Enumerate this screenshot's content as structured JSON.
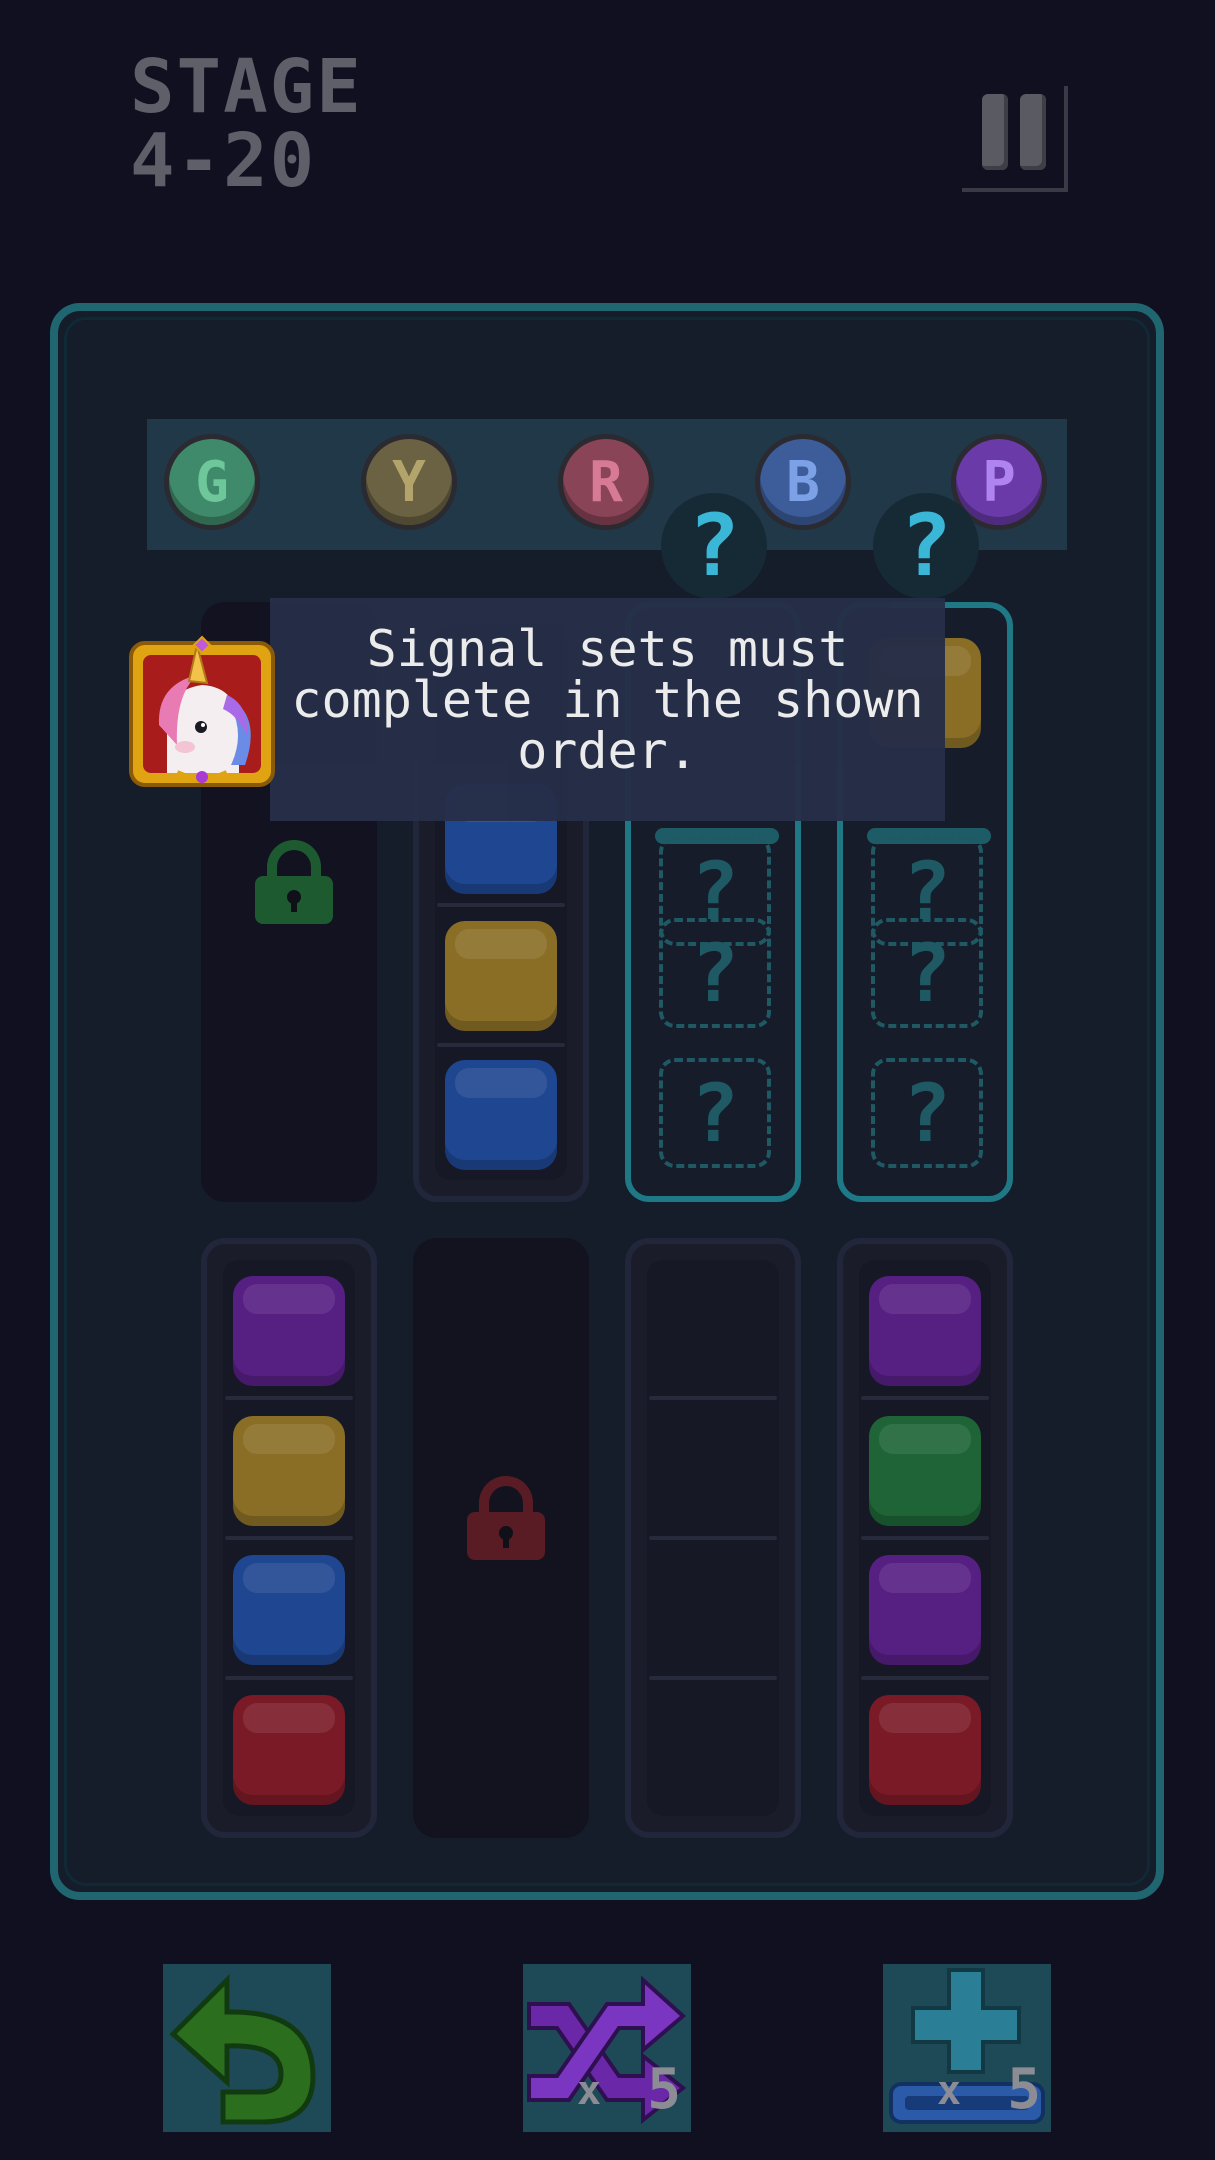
{
  "header": {
    "stage_line1": "STAGE",
    "stage_line2": "4-20",
    "pause_icon": "pause-icon"
  },
  "signals": [
    {
      "letter": "G",
      "color": "#3f8a6a",
      "text_color": "#6dc79a"
    },
    {
      "letter": "Y",
      "color": "#6a6242",
      "text_color": "#b3a46c"
    },
    {
      "letter": "R",
      "color": "#8a4458",
      "text_color": "#d67a96"
    },
    {
      "letter": "B",
      "color": "#3d5c9a",
      "text_color": "#7da1e6"
    },
    {
      "letter": "P",
      "color": "#6a3aa8",
      "text_color": "#b084f0"
    }
  ],
  "hidden_markers": [
    "?",
    "?"
  ],
  "tooltip": {
    "text": "Signal sets must complete in the shown order.",
    "avatar_icon": "unicorn-avatar-icon"
  },
  "tubes_row1": [
    {
      "state": "locked",
      "lock_color": "green"
    },
    {
      "blocks": [
        "blue",
        "yellow",
        "blue"
      ]
    },
    {
      "state": "hidden",
      "slots": [
        "?",
        "?",
        "?"
      ]
    },
    {
      "state": "hidden",
      "top_block": "yellow",
      "slots": [
        "?",
        "?",
        "?"
      ]
    }
  ],
  "tubes_row2": [
    {
      "blocks": [
        "purple",
        "yellow",
        "blue",
        "red"
      ]
    },
    {
      "state": "locked",
      "lock_color": "red"
    },
    {
      "blocks": []
    },
    {
      "blocks": [
        "purple",
        "green",
        "purple",
        "red"
      ]
    }
  ],
  "block_colors": {
    "blue": "#1f4690",
    "yellow": "#8a6e26",
    "purple": "#561f82",
    "red": "#7a1a26",
    "green": "#1e6436"
  },
  "tools": [
    {
      "name": "undo",
      "icon": "undo-arrow-icon",
      "count": ""
    },
    {
      "name": "shuffle",
      "icon": "shuffle-icon",
      "count": "5",
      "times": "x"
    },
    {
      "name": "add-tube",
      "icon": "add-tube-icon",
      "count": "5",
      "times": "x"
    }
  ]
}
